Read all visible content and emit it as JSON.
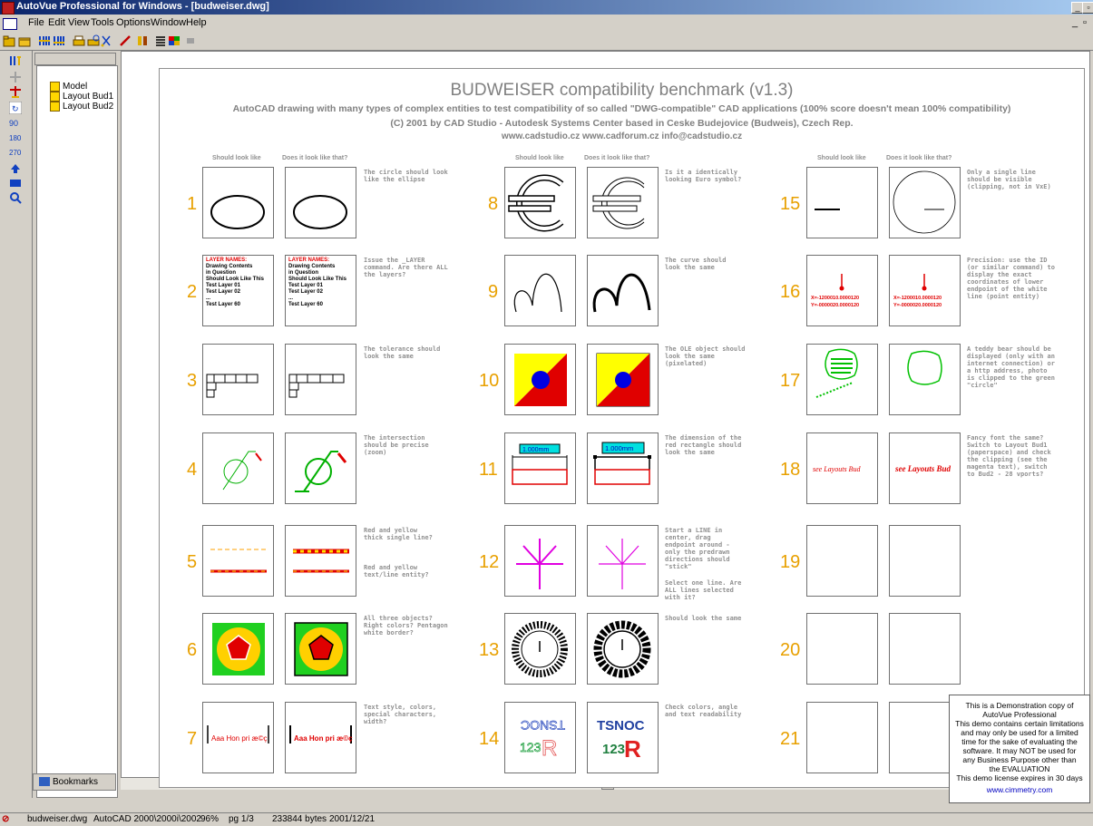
{
  "window": {
    "title": "AutoVue Professional for Windows - [budweiser.dwg]"
  },
  "menu": [
    "File",
    "Edit",
    "View",
    "Tools",
    "Options",
    "Window",
    "Help"
  ],
  "tree": {
    "items": [
      "Model",
      "Layout Bud1",
      "Layout Bud2"
    ]
  },
  "bookmarks_label": "Bookmarks",
  "drawing": {
    "title": "BUDWEISER compatibility benchmark (v1.3)",
    "subtitle1": "AutoCAD drawing with many types of complex entities to test compatibility of so called \"DWG-compatible\" CAD applications (100% score doesn't mean 100% compatibility)",
    "subtitle2": "(C) 2001 by CAD Studio - Autodesk Systems Center based in Ceske Budejovice (Budweis), Czech Rep.",
    "links": "www.cadstudio.cz    www.cadforum.cz    info@cadstudio.cz",
    "col_should": "Should look like",
    "col_does": "Does it look like that?",
    "layer_text": {
      "line1": "LAYER NAMES:",
      "line2": "Drawing Contents",
      "line3": "in Question",
      "line4": "Should Look Like This",
      "line5": "Test Layer 01",
      "line6": "Test Layer 02",
      "line7": "...",
      "line8": "Test Layer 60"
    },
    "coord_text": {
      "x": "X=-1200010.0000120",
      "y": "Y=-0000020.0000120"
    },
    "tests": [
      {
        "n": "1",
        "note": "The circle should look like the ellipse"
      },
      {
        "n": "2",
        "note": "Issue the _LAYER command. Are there ALL the layers?"
      },
      {
        "n": "3",
        "note": "The tolerance should look the same"
      },
      {
        "n": "4",
        "note": "The intersection should be precise (zoom)"
      },
      {
        "n": "5",
        "note": "Red and yellow thick single line?",
        "note2": "Red and yellow text/line entity?"
      },
      {
        "n": "6",
        "note": "All three objects? Right colors? Pentagon white border?"
      },
      {
        "n": "7",
        "note": "Text style, colors, special characters, width?"
      },
      {
        "n": "8",
        "note": "Is it a identically looking Euro symbol?"
      },
      {
        "n": "9",
        "note": "The curve should look the same"
      },
      {
        "n": "10",
        "note": "The OLE object should look the same (pixelated)"
      },
      {
        "n": "11",
        "note": "The dimension of the red rectangle should look the same"
      },
      {
        "n": "12",
        "note": "Start a LINE in center, drag endpoint around - only the predrawn directions should \"stick\"",
        "note2": "Select one line. Are ALL lines selected with it?"
      },
      {
        "n": "13",
        "note": "Should look the same"
      },
      {
        "n": "14",
        "note": "Check colors, angle and text readability"
      },
      {
        "n": "15",
        "note": "Only a single line should be visible (clipping, not in VxE)"
      },
      {
        "n": "16",
        "note": "Precision: use the ID (or similar command) to display the exact coordinates of lower endpoint of the white line (point entity)"
      },
      {
        "n": "17",
        "note": "A teddy bear should be displayed (only with an internet connection) or a http address, photo is clipped to the green \"circle\""
      },
      {
        "n": "18",
        "note": "Fancy font the same? Switch to Layout Bud1 (paperspace) and check the clipping (see the magenta text), switch to Bud2 - 28 vports?"
      },
      {
        "n": "19",
        "note": ""
      },
      {
        "n": "20",
        "note": ""
      },
      {
        "n": "21",
        "note": ""
      }
    ],
    "t7_text": "Aaa Hon pri æ©ç",
    "t18_text": "see Layouts Bud",
    "t10_colors": {
      "red": "#e00000",
      "yellow": "#ffff00",
      "blue": "#0000e0"
    },
    "t14_text": {
      "line1": "TSNOC",
      "line2": "123",
      "r": "R"
    },
    "dim_value": "1.000mm"
  },
  "demo_notice": {
    "line1": "This is a Demonstration copy of",
    "line2": "AutoVue Professional",
    "line3": "This demo contains certain limitations",
    "line4": "and may only be used for a limited",
    "line5": "time for the sake of evaluating the",
    "line6": "software. It may NOT be used for",
    "line7": "any Business Purpose other than",
    "line8": "the EVALUATION",
    "line9": "This demo license expires in 30 days",
    "link": "www.cimmetry.com"
  },
  "status": {
    "file": "budweiser.dwg",
    "format": "AutoCAD 2000\\2000i\\2002",
    "zoom": "96%",
    "page": "pg 1/3",
    "size": "233844 bytes",
    "date": "2001/12/21"
  }
}
